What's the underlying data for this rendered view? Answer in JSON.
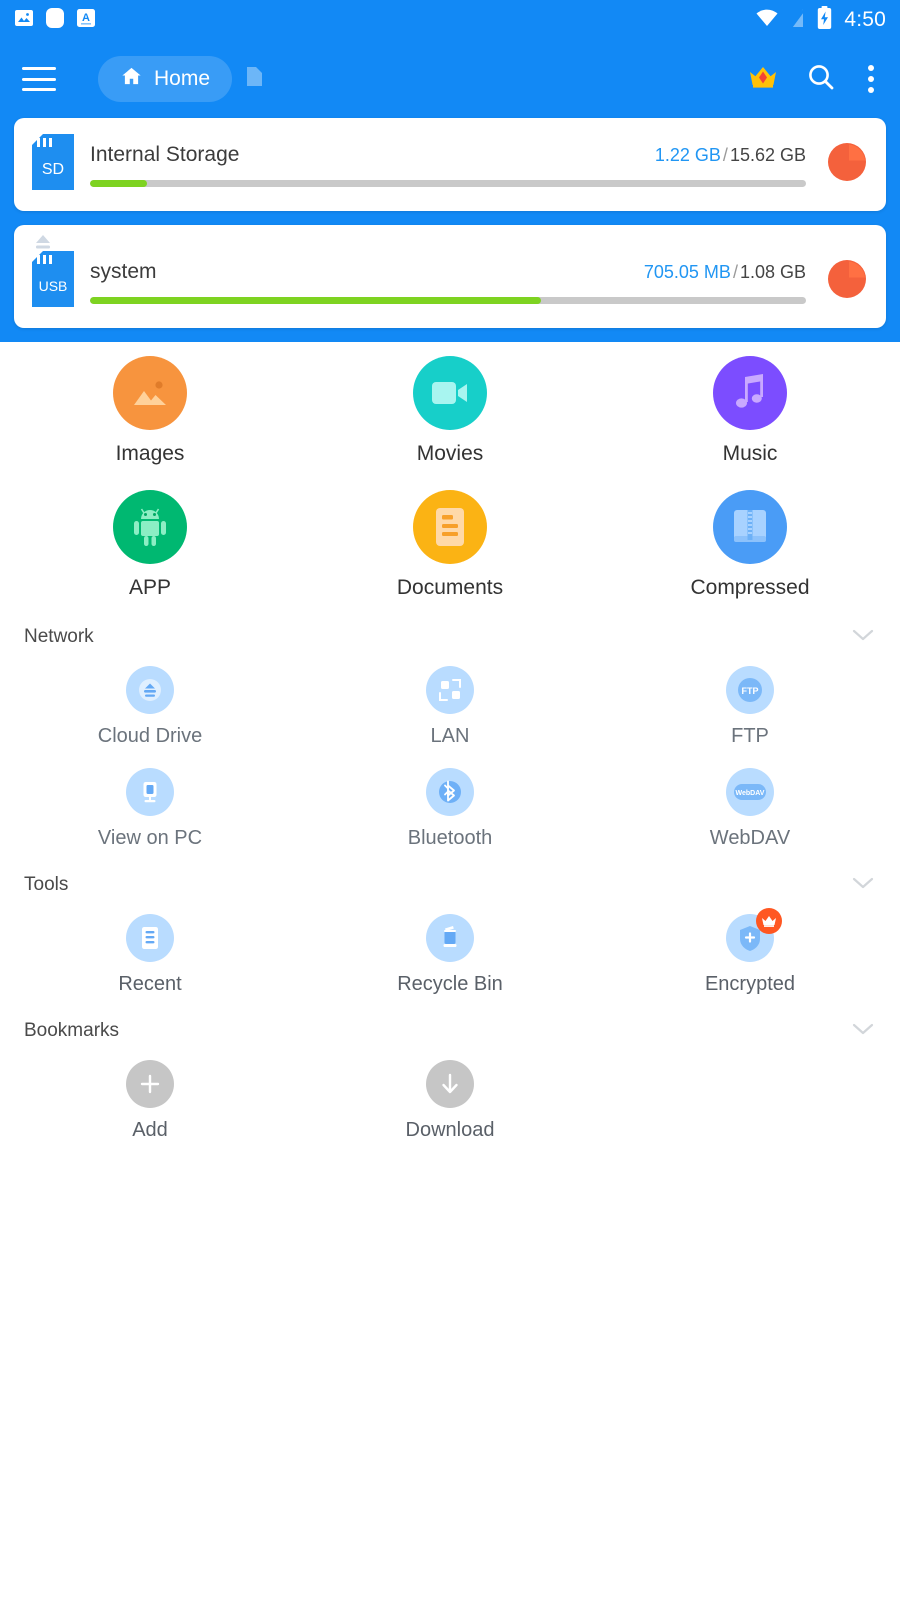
{
  "statusbar": {
    "time": "4:50",
    "left_icons": [
      "image-icon",
      "rounded-square-icon",
      "letter-a-icon"
    ],
    "right_icons": [
      "wifi-icon",
      "signal-off-icon",
      "battery-charging-icon"
    ]
  },
  "toolbar": {
    "menu_icon": "hamburger-icon",
    "breadcrumb_label": "Home",
    "home_icon": "home-icon",
    "file_icon": "file-icon",
    "crown_icon": "crown-icon",
    "search_icon": "search-icon",
    "overflow_icon": "overflow-menu-icon",
    "accent": "#1289f5"
  },
  "storage": [
    {
      "name": "Internal Storage",
      "icon": "sd-card-icon",
      "icon_text": "SD",
      "used": "1.22 GB",
      "separator": "/",
      "total": "15.62 GB",
      "percent": 8,
      "ejectable": false,
      "chart_icon": "pie-chart-icon"
    },
    {
      "name": "system",
      "icon": "usb-drive-icon",
      "icon_text": "USB",
      "used": "705.05 MB",
      "separator": "/",
      "total": "1.08 GB",
      "percent": 63,
      "ejectable": true,
      "eject_icon": "eject-icon",
      "chart_icon": "pie-chart-icon"
    }
  ],
  "categories": [
    {
      "label": "Images",
      "icon": "image-icon",
      "color": "#f7943e"
    },
    {
      "label": "Movies",
      "icon": "video-icon",
      "color": "#17cfc9"
    },
    {
      "label": "Music",
      "icon": "music-note-icon",
      "color": "#7c4dff"
    },
    {
      "label": "APP",
      "icon": "android-icon",
      "color": "#00b871"
    },
    {
      "label": "Documents",
      "icon": "document-icon",
      "color": "#fbb314"
    },
    {
      "label": "Compressed",
      "icon": "archive-icon",
      "color": "#4a9cf6"
    }
  ],
  "sections": [
    {
      "title": "Network",
      "collapse_icon": "chevron-down-icon",
      "items": [
        {
          "label": "Cloud Drive",
          "icon": "cloud-drive-icon"
        },
        {
          "label": "LAN",
          "icon": "lan-icon"
        },
        {
          "label": "FTP",
          "icon": "ftp-icon",
          "icon_text": "FTP"
        },
        {
          "label": "View on PC",
          "icon": "monitor-icon"
        },
        {
          "label": "Bluetooth",
          "icon": "bluetooth-icon"
        },
        {
          "label": "WebDAV",
          "icon": "webdav-icon",
          "icon_text": "WebDAV"
        }
      ]
    },
    {
      "title": "Tools",
      "collapse_icon": "chevron-down-icon",
      "items": [
        {
          "label": "Recent",
          "icon": "recent-document-icon"
        },
        {
          "label": "Recycle Bin",
          "icon": "trash-icon"
        },
        {
          "label": "Encrypted",
          "icon": "shield-plus-icon",
          "badge": "crown-badge-icon"
        }
      ]
    },
    {
      "title": "Bookmarks",
      "collapse_icon": "chevron-down-icon",
      "items": [
        {
          "label": "Add",
          "icon": "plus-icon",
          "gray": true
        },
        {
          "label": "Download",
          "icon": "download-arrow-icon",
          "gray": true
        }
      ]
    }
  ]
}
